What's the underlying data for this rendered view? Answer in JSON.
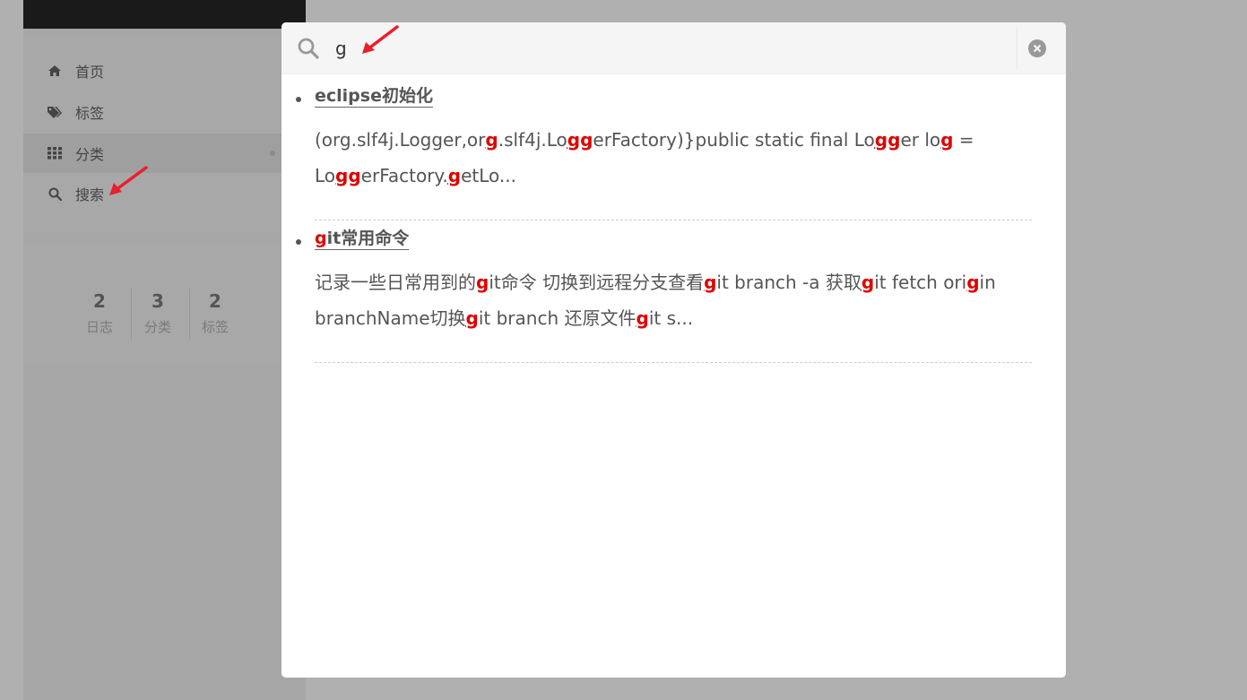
{
  "sidebar": {
    "menu": [
      {
        "label": "首页",
        "icon": "home-icon"
      },
      {
        "label": "标签",
        "icon": "tags-icon"
      },
      {
        "label": "分类",
        "icon": "th-icon"
      },
      {
        "label": "搜索",
        "icon": "search-icon"
      }
    ],
    "stats": [
      {
        "count": "2",
        "label": "日志"
      },
      {
        "count": "3",
        "label": "分类"
      },
      {
        "count": "2",
        "label": "标签"
      }
    ]
  },
  "search": {
    "query": "g",
    "results": [
      {
        "title_pre": "",
        "title_hl": "",
        "title_post": "eclipse初始化",
        "excerpt": [
          {
            "t": "(org.slf4j.Logger,or",
            "h": false
          },
          {
            "t": "g",
            "h": true
          },
          {
            "t": ".slf4j.Lo",
            "h": false
          },
          {
            "t": "gg",
            "h": true
          },
          {
            "t": "erFactory)}public static final Lo",
            "h": false
          },
          {
            "t": "gg",
            "h": true
          },
          {
            "t": "er lo",
            "h": false
          },
          {
            "t": "g",
            "h": true
          },
          {
            "t": " = Lo",
            "h": false
          },
          {
            "t": "gg",
            "h": true
          },
          {
            "t": "erFactory.",
            "h": false
          },
          {
            "t": "g",
            "h": true
          },
          {
            "t": "etLo...",
            "h": false
          }
        ]
      },
      {
        "title_pre": "",
        "title_hl": "g",
        "title_post": "it常用命令",
        "excerpt": [
          {
            "t": "记录一些日常用到的",
            "h": false
          },
          {
            "t": "g",
            "h": true
          },
          {
            "t": "it命令 切换到远程分支查看",
            "h": false
          },
          {
            "t": "g",
            "h": true
          },
          {
            "t": "it branch -a 获取",
            "h": false
          },
          {
            "t": "g",
            "h": true
          },
          {
            "t": "it fetch ori",
            "h": false
          },
          {
            "t": "g",
            "h": true
          },
          {
            "t": "in branchName切换",
            "h": false
          },
          {
            "t": "g",
            "h": true
          },
          {
            "t": "it branch 还原文件",
            "h": false
          },
          {
            "t": "g",
            "h": true
          },
          {
            "t": "it s...",
            "h": false
          }
        ]
      }
    ]
  },
  "colors": {
    "highlight": "#e00000",
    "arrow": "#e8202a"
  }
}
